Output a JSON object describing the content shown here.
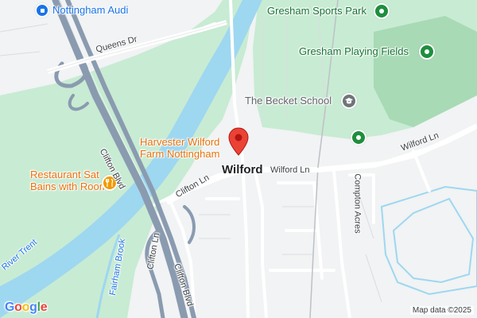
{
  "map": {
    "places": {
      "nottingham_audi": "Nottingham Audi",
      "gresham_sports_park": "Gresham Sports Park",
      "gresham_playing_fields": "Gresham Playing Fields",
      "becket_school": "The Becket School",
      "harvester_line1": "Harvester Wilford",
      "harvester_line2": "Farm Nottingham",
      "restaurant_line1": "Restaurant Sat",
      "restaurant_line2": "Bains with Rooms",
      "wilford": "Wilford"
    },
    "roads": {
      "queens_dr": "Queens Dr",
      "clifton_blvd_1": "Clifton Blvd",
      "clifton_blvd_2": "Clifton Blvd",
      "clifton_ln_1": "Clifton Ln",
      "clifton_ln_2": "Clifton Ln",
      "wilford_ln_1": "Wilford Ln",
      "wilford_ln_2": "Wilford Ln",
      "compton_acres": "Compton Acres",
      "fairham_brook": "Fairham Brook",
      "river_trent": "River Trent"
    },
    "icons": {
      "audi": "car-icon",
      "sports_park": "park-icon",
      "playing_fields": "park-icon",
      "school": "school-icon",
      "harvester": "location-pin-icon",
      "restaurant": "restaurant-icon",
      "unnamed_green": "park-icon"
    },
    "logo": "Google",
    "attribution": "Map data ©2025"
  },
  "colors": {
    "background": "#f1f3f4",
    "park": "#c8ebd3",
    "park_dark": "#a8dab5",
    "water": "#9ed7f0",
    "highway": "#8a9bb0",
    "road": "#ffffff",
    "pin_red": "#ea4335"
  }
}
